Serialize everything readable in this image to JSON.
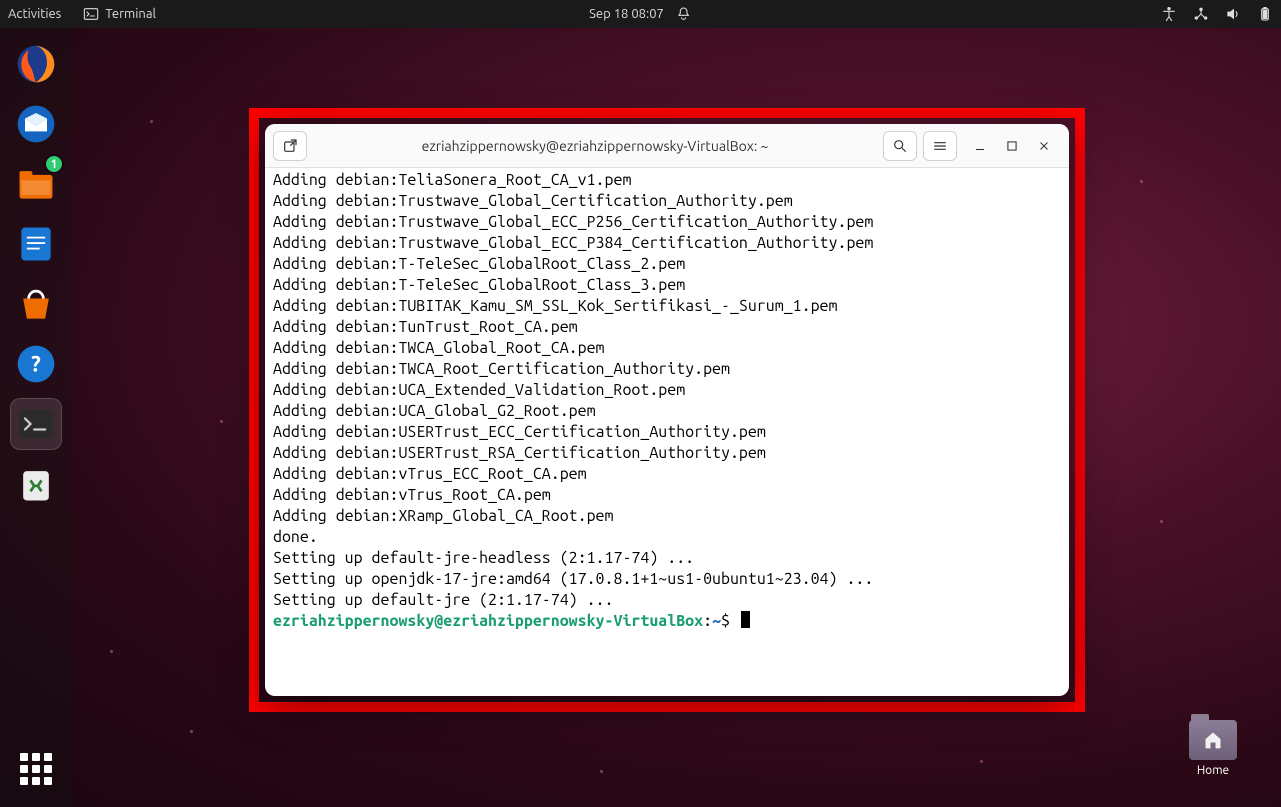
{
  "topbar": {
    "activities_label": "Activities",
    "app_label": "Terminal",
    "datetime": "Sep 18  08:07"
  },
  "dock": {
    "files_badge": "1"
  },
  "desktop": {
    "home_label": "Home"
  },
  "terminal": {
    "title": "ezriahzippernowsky@ezriahzippernowsky-VirtualBox: ~",
    "lines": [
      "Adding debian:TeliaSonera_Root_CA_v1.pem",
      "Adding debian:Trustwave_Global_Certification_Authority.pem",
      "Adding debian:Trustwave_Global_ECC_P256_Certification_Authority.pem",
      "Adding debian:Trustwave_Global_ECC_P384_Certification_Authority.pem",
      "Adding debian:T-TeleSec_GlobalRoot_Class_2.pem",
      "Adding debian:T-TeleSec_GlobalRoot_Class_3.pem",
      "Adding debian:TUBITAK_Kamu_SM_SSL_Kok_Sertifikasi_-_Surum_1.pem",
      "Adding debian:TunTrust_Root_CA.pem",
      "Adding debian:TWCA_Global_Root_CA.pem",
      "Adding debian:TWCA_Root_Certification_Authority.pem",
      "Adding debian:UCA_Extended_Validation_Root.pem",
      "Adding debian:UCA_Global_G2_Root.pem",
      "Adding debian:USERTrust_ECC_Certification_Authority.pem",
      "Adding debian:USERTrust_RSA_Certification_Authority.pem",
      "Adding debian:vTrus_ECC_Root_CA.pem",
      "Adding debian:vTrus_Root_CA.pem",
      "Adding debian:XRamp_Global_CA_Root.pem",
      "done.",
      "Setting up default-jre-headless (2:1.17-74) ...",
      "Setting up openjdk-17-jre:amd64 (17.0.8.1+1~us1-0ubuntu1~23.04) ...",
      "Setting up default-jre (2:1.17-74) ..."
    ],
    "prompt": {
      "user_host": "ezriahzippernowsky@ezriahzippernowsky-VirtualBox",
      "colon": ":",
      "path": "~",
      "suffix": "$ "
    }
  }
}
